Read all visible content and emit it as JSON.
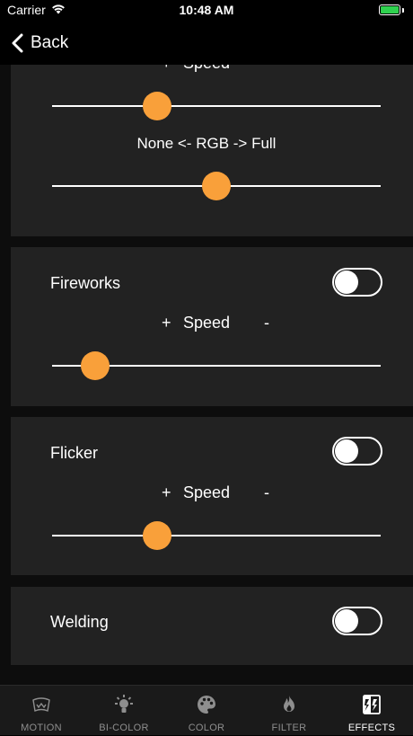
{
  "status_bar": {
    "carrier": "Carrier",
    "time": "10:48 AM",
    "battery_level": 1.0,
    "battery_color": "#2fd14f"
  },
  "nav": {
    "back_label": "Back",
    "back_icon": "chevron-left-icon"
  },
  "colors": {
    "accent": "#f9a03a",
    "card_background": "#222222"
  },
  "cards": {
    "top": {
      "speed": {
        "plus": "+",
        "label": "Speed",
        "minus": "-"
      },
      "speed_value": 0.32,
      "rgb_label": "None <- RGB -> Full",
      "rgb_value": 0.5
    },
    "fireworks": {
      "title": "Fireworks",
      "enabled": false,
      "speed": {
        "plus": "+",
        "label": "Speed",
        "minus": "-"
      },
      "speed_value": 0.13
    },
    "flicker": {
      "title": "Flicker",
      "enabled": false,
      "speed": {
        "plus": "+",
        "label": "Speed",
        "minus": "-"
      },
      "speed_value": 0.32
    },
    "welding": {
      "title": "Welding",
      "enabled": false
    }
  },
  "tabs": [
    {
      "label": "MOTION",
      "icon": "motion-icon",
      "active": false
    },
    {
      "label": "BI-COLOR",
      "icon": "bulb-icon",
      "active": false
    },
    {
      "label": "COLOR",
      "icon": "palette-icon",
      "active": false
    },
    {
      "label": "FILTER",
      "icon": "flame-icon",
      "active": false
    },
    {
      "label": "EFFECTS",
      "icon": "effects-icon",
      "active": true
    }
  ]
}
